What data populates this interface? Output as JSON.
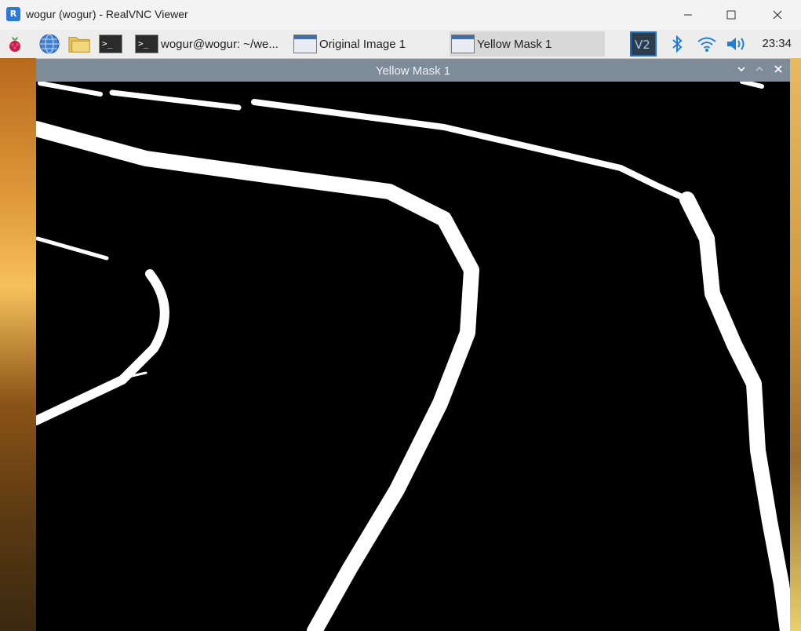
{
  "vnc_window": {
    "title": "wogur (wogur) - RealVNC Viewer",
    "logo_text": "R"
  },
  "taskbar": {
    "tasks": [
      {
        "label": "wogur@wogur: ~/we...",
        "icon": "terminal-icon"
      },
      {
        "label": "Original Image 1",
        "icon": "window-icon"
      },
      {
        "label": "Yellow Mask 1",
        "icon": "window-icon"
      }
    ],
    "launchers": [
      "raspberry-pi-menu-icon",
      "web-browser-icon",
      "file-manager-icon",
      "terminal-icon"
    ],
    "tray_icons": [
      "vnc-server-icon",
      "bluetooth-icon",
      "wifi-icon",
      "volume-icon"
    ],
    "clock": "23:34"
  },
  "mask_window": {
    "title": "Yellow Mask 1"
  },
  "colors": {
    "mask_background": "#000000",
    "mask_foreground": "#ffffff",
    "mask_titlebar": "#7e8c99",
    "taskbar": "#ededed",
    "vnc_blue": "#2a79d8"
  }
}
